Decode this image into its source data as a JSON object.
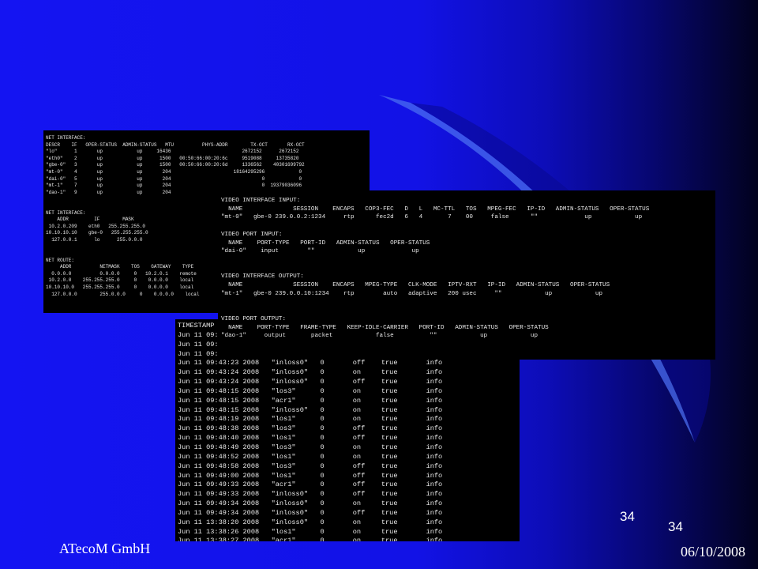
{
  "slide": {
    "page_number": "34",
    "company": "ATecoM GmbH",
    "date": "06/10/2008",
    "colors": {
      "background_start": "#1414f2",
      "background_end": "#02021e",
      "swoosh": "#4a6cf0",
      "terminal_bg": "#000000",
      "terminal_text": "#e8e8e8"
    }
  },
  "net_terminal": {
    "lines": [
      "NET INTERFACE:",
      "DESCR    IF   OPER-STATUS  ADMIN-STATUS   MTU          PHYS-ADDR        TX-OCT       RX-OCT",
      "\"lo\"      1       up            up     16436                         2672152      2672152",
      "\"eth0\"    2       up            up      1500   00:50:66:00:20:6c     9519088     13735820",
      "\"gbe-0\"   3       up            up      1500   00:50:66:00:20:6d     1336562    40301699792",
      "\"mt-0\"    4       up            up       204                      18164295296            0",
      "\"dai-0\"   5       up            up       204                                0            0",
      "\"mt-1\"    7       up            up       204                                0  19379036096",
      "\"dao-1\"   9       up            up       204",
      "",
      "",
      "NET INTERFACE:",
      "    ADDR         IF        MASK",
      " 10.2.0.209    eth0   255.255.255.0",
      "10.10.10.10    gbe-0   255.255.255.0",
      "  127.0.0.1      lo      255.0.0.0",
      "",
      "",
      "NET ROUTE:",
      "     ADDR          NETMASK    TOS    GATEWAY    TYPE",
      "  0.0.0.0          0.0.0.0     0   10.2.0.1    remote",
      " 10.2.0.0    255.255.255.0     0    0.0.0.0    local",
      "10.10.10.0   255.255.255.0     0    0.0.0.0    local",
      "  127.0.0.0        255.0.0.0     0    0.0.0.0    local"
    ]
  },
  "log_terminal": {
    "lines": [
      "TIMESTAMP",
      "Jun 11 09:",
      "Jun 11 09:",
      "Jun 11 09:",
      "Jun 11 09:43:23 2008   \"inloss0\"   0       off    true       info",
      "Jun 11 09:43:24 2008   \"inloss0\"   0       on     true       info",
      "Jun 11 09:43:24 2008   \"inloss0\"   0       off    true       info",
      "Jun 11 09:48:15 2008   \"los3\"      0       on     true       info",
      "Jun 11 09:48:15 2008   \"acr1\"      0       on     true       info",
      "Jun 11 09:48:15 2008   \"inloss0\"   0       on     true       info",
      "Jun 11 09:48:19 2008   \"los1\"      0       on     true       info",
      "Jun 11 09:48:38 2008   \"los3\"      0       off    true       info",
      "Jun 11 09:48:40 2008   \"los1\"      0       off    true       info",
      "Jun 11 09:48:49 2008   \"los3\"      0       on     true       info",
      "Jun 11 09:48:52 2008   \"los1\"      0       on     true       info",
      "Jun 11 09:48:58 2008   \"los3\"      0       off    true       info",
      "Jun 11 09:49:00 2008   \"los1\"      0       off    true       info",
      "Jun 11 09:49:33 2008   \"acr1\"      0       off    true       info",
      "Jun 11 09:49:33 2008   \"inloss0\"   0       off    true       info",
      "Jun 11 09:49:34 2008   \"inloss0\"   0       on     true       info",
      "Jun 11 09:49:34 2008   \"inloss0\"   0       off    true       info",
      "Jun 11 13:38:20 2008   \"inloss0\"   0       on     true       info",
      "Jun 11 13:38:26 2008   \"los1\"      0       on     true       info",
      "Jun 11 13:38:27 2008   \"acr1\"      0       on     true       info"
    ]
  },
  "video_terminal": {
    "lines": [
      "VIDEO INTERFACE INPUT:",
      "  NAME              SESSION    ENCAPS   COP3-FEC   D   L   MC-TTL   TOS   MPEG-FEC   IP-ID   ADMIN-STATUS   OPER-STATUS",
      "\"mt-0\"   gbe-0 239.0.0.2:1234     rtp      fec2d   6   4       7    00     false      \"\"             up            up",
      "",
      "VIDEO PORT INPUT:",
      "  NAME    PORT-TYPE   PORT-ID   ADMIN-STATUS   OPER-STATUS",
      "\"dai-0\"    input        \"\"            up             up",
      "",
      "",
      "VIDEO INTERFACE OUTPUT:",
      "  NAME              SESSION    ENCAPS   MPEG-TYPE   CLK-MODE   IPTV-RXT   IP-ID   ADMIN-STATUS   OPER-STATUS",
      "\"mt-1\"   gbe-0 239.0.0.10:1234    rtp        auto   adaptive   200 usec     \"\"            up            up",
      "",
      "",
      "VIDEO PORT OUTPUT:",
      "  NAME    PORT-TYPE   FRAME-TYPE   KEEP-IDLE-CARRIER   PORT-ID   ADMIN-STATUS   OPER-STATUS",
      "\"dao-1\"     output       packet            false          \"\"            up            up"
    ]
  }
}
